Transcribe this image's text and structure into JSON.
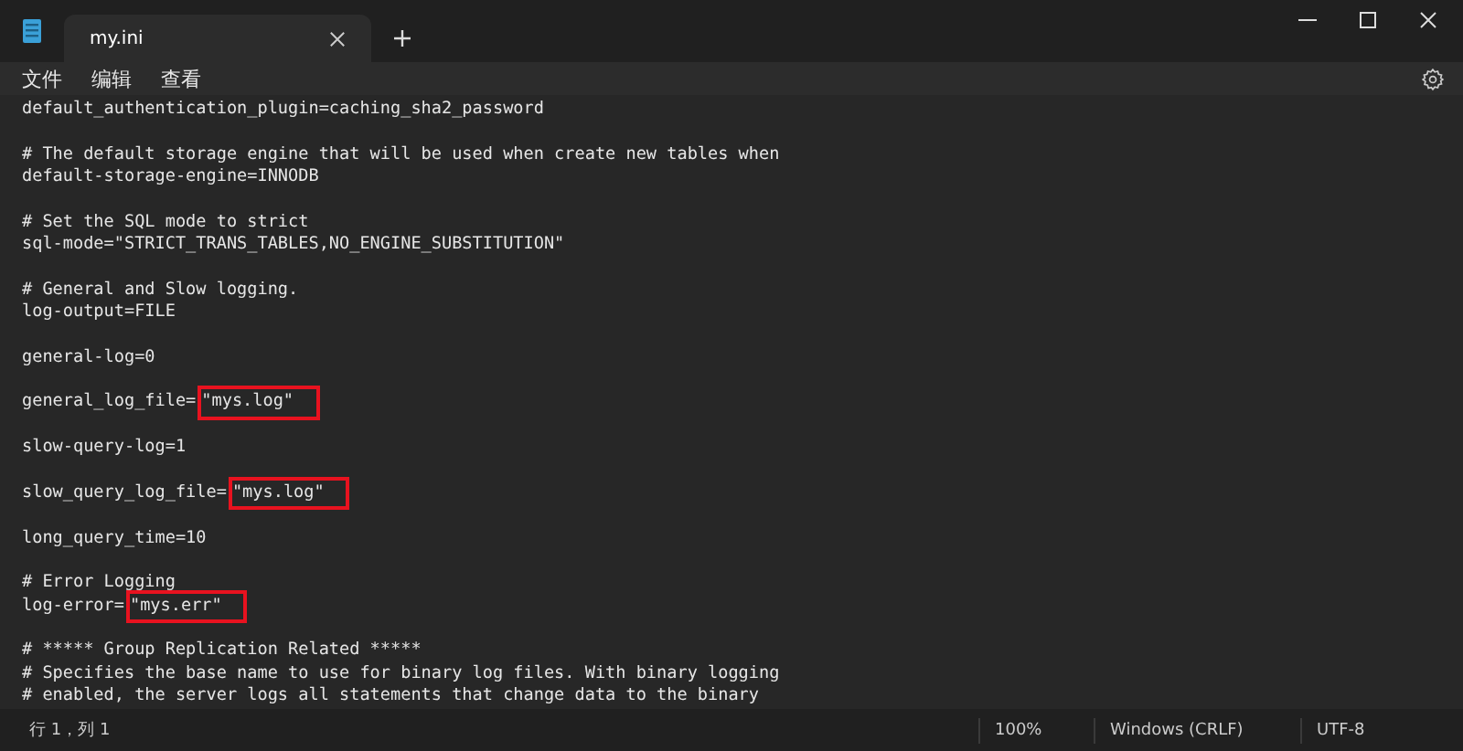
{
  "window": {
    "tabs": [
      {
        "title": "my.ini",
        "selected": true
      }
    ]
  },
  "menu": [
    "文件",
    "编辑",
    "查看"
  ],
  "editor": {
    "lines": [
      {
        "kind": "code",
        "text": "default_authentication_plugin=caching_sha2_password"
      },
      {
        "kind": "blank"
      },
      {
        "kind": "code",
        "text": "# The default storage engine that will be used when create new tables when"
      },
      {
        "kind": "code",
        "text": "default-storage-engine=INNODB"
      },
      {
        "kind": "blank"
      },
      {
        "kind": "code",
        "text": "# Set the SQL mode to strict"
      },
      {
        "kind": "code",
        "text": "sql-mode=\"STRICT_TRANS_TABLES,NO_ENGINE_SUBSTITUTION\""
      },
      {
        "kind": "blank"
      },
      {
        "kind": "code",
        "text": "# General and Slow logging."
      },
      {
        "kind": "code",
        "text": "log-output=FILE"
      },
      {
        "kind": "blank"
      },
      {
        "kind": "code",
        "text": "general-log=0"
      },
      {
        "kind": "blank"
      },
      {
        "kind": "code",
        "text": "general_log_file=",
        "highlight": "\"mys.log\""
      },
      {
        "kind": "blank"
      },
      {
        "kind": "code",
        "text": "slow-query-log=1"
      },
      {
        "kind": "blank"
      },
      {
        "kind": "code",
        "text": "slow_query_log_file=",
        "highlight": "\"mys.log\""
      },
      {
        "kind": "blank"
      },
      {
        "kind": "code",
        "text": "long_query_time=10"
      },
      {
        "kind": "blank"
      },
      {
        "kind": "code",
        "text": "# Error Logging"
      },
      {
        "kind": "code",
        "text": "log-error=",
        "highlight": "\"mys.err\""
      },
      {
        "kind": "blank"
      },
      {
        "kind": "code",
        "text": "# ***** Group Replication Related *****"
      },
      {
        "kind": "code",
        "text": "# Specifies the base name to use for binary log files. With binary logging"
      },
      {
        "kind": "code",
        "text": "# enabled, the server logs all statements that change data to the binary"
      }
    ]
  },
  "status_bar": {
    "position": "行 1，列 1",
    "zoom": "100%",
    "line_ending": "Windows (CRLF)",
    "encoding": "UTF-8"
  }
}
